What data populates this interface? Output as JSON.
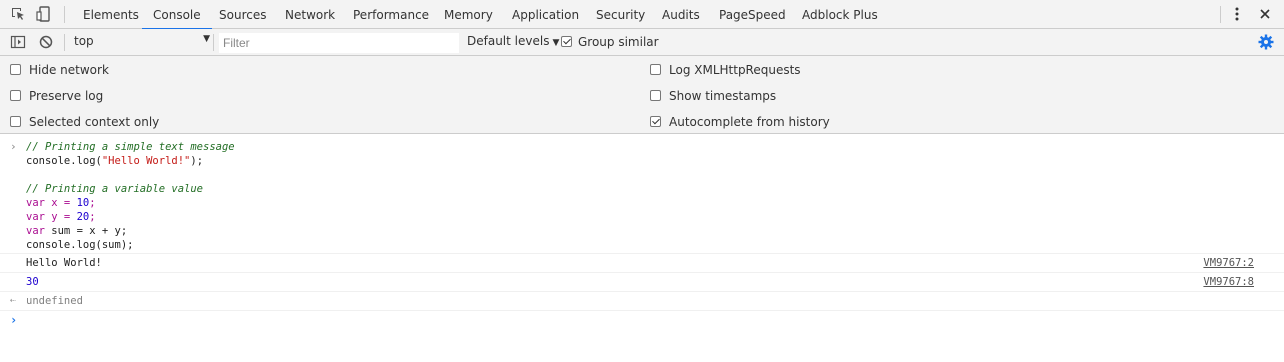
{
  "tabs": {
    "items": [
      {
        "label": "Elements"
      },
      {
        "label": "Console"
      },
      {
        "label": "Sources"
      },
      {
        "label": "Network"
      },
      {
        "label": "Performance"
      },
      {
        "label": "Memory"
      },
      {
        "label": "Application"
      },
      {
        "label": "Security"
      },
      {
        "label": "Audits"
      },
      {
        "label": "PageSpeed"
      },
      {
        "label": "Adblock Plus"
      }
    ],
    "active": "Console"
  },
  "toolbar": {
    "context": "top",
    "filter_placeholder": "Filter",
    "levels_label": "Default levels",
    "group_similar_label": "Group similar",
    "group_similar_checked": true
  },
  "settings": {
    "hide_network": {
      "label": "Hide network",
      "checked": false
    },
    "preserve_log": {
      "label": "Preserve log",
      "checked": false
    },
    "selected_context": {
      "label": "Selected context only",
      "checked": false
    },
    "log_xhr": {
      "label": "Log XMLHttpRequests",
      "checked": false
    },
    "show_timestamps": {
      "label": "Show timestamps",
      "checked": false
    },
    "autocomplete": {
      "label": "Autocomplete from history",
      "checked": true
    }
  },
  "console": {
    "input": {
      "line1": "// Printing a simple text message",
      "line2_pre": "console.log(",
      "line2_str": "\"Hello World!\"",
      "line2_post": ");",
      "line4": "// Printing a variable value",
      "line5_kw": "var",
      "line5_mid": " x = ",
      "line5_num": "10",
      "line5_end": ";",
      "line6_kw": "var",
      "line6_mid": " y = ",
      "line6_num": "20",
      "line6_end": ";",
      "line7_kw": "var",
      "line7_rest": " sum = x + y;",
      "line8": "console.log(sum);"
    },
    "outputs": [
      {
        "text": "Hello World!",
        "source": "VM9767:2"
      },
      {
        "text": "30",
        "source": "VM9767:8"
      }
    ],
    "result": "undefined"
  },
  "colors": {
    "accent": "#1a73e8",
    "comment": "#236e25",
    "keyword": "#aa0d91",
    "string": "#c41a16",
    "number": "#1c00cf"
  }
}
